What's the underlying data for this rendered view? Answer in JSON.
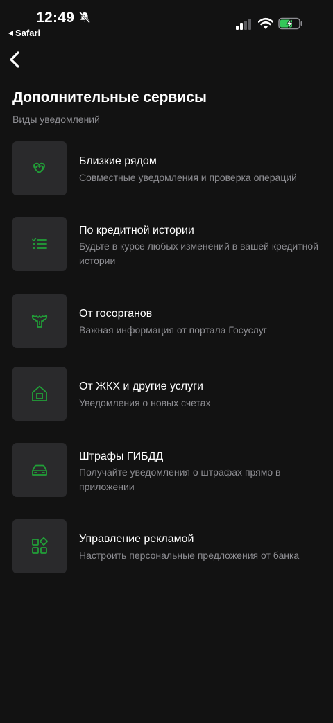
{
  "status_bar": {
    "time": "12:49",
    "back_app": "Safari"
  },
  "colors": {
    "accent": "#21a038",
    "background": "#121212",
    "tile": "#2a2a2c",
    "muted_text": "#8e8e93"
  },
  "header": {
    "title": "Дополнительные сервисы",
    "section_label": "Виды уведомлений"
  },
  "services": [
    {
      "icon": "hearts-icon",
      "title": "Близкие рядом",
      "subtitle": "Совместные уведомления и проверка операций"
    },
    {
      "icon": "checklist-icon",
      "title": "По кредитной истории",
      "subtitle": "Будьте в курсе любых изменений в вашей кредитной истории"
    },
    {
      "icon": "coat-of-arms-icon",
      "title": "От госорганов",
      "subtitle": "Важная информация от портала Госуслуг"
    },
    {
      "icon": "house-icon",
      "title": "От ЖКХ и другие услуги",
      "subtitle": "Уведомления о новых счетах"
    },
    {
      "icon": "car-icon",
      "title": "Штрафы ГИБДД",
      "subtitle": "Получайте уведомления о штрафах прямо в приложении"
    },
    {
      "icon": "widgets-icon",
      "title": "Управление рекламой",
      "subtitle": "Настроить персональные предложения от банка"
    }
  ]
}
